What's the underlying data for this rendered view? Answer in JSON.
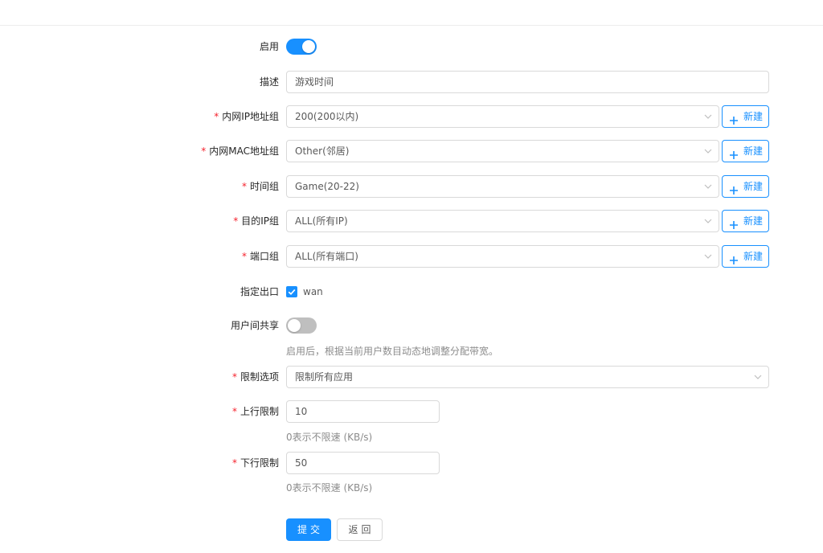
{
  "form": {
    "enable": {
      "label": "启用",
      "on": true
    },
    "description": {
      "label": "描述",
      "value": "游戏时间"
    },
    "lan_ip_group": {
      "required": "*",
      "label": "内网IP地址组",
      "value": "200(200以内)",
      "new_label": "新建"
    },
    "lan_mac_group": {
      "required": "*",
      "label": "内网MAC地址组",
      "value": "Other(邻居)",
      "new_label": "新建"
    },
    "time_group": {
      "required": "*",
      "label": "时间组",
      "value": "Game(20-22)",
      "new_label": "新建"
    },
    "dest_ip_group": {
      "required": "*",
      "label": "目的IP组",
      "value": "ALL(所有IP)",
      "new_label": "新建"
    },
    "port_group": {
      "required": "*",
      "label": "端口组",
      "value": "ALL(所有端口)",
      "new_label": "新建"
    },
    "egress": {
      "label": "指定出口",
      "option_label": "wan",
      "checked": true
    },
    "user_share": {
      "label": "用户间共享",
      "on": false,
      "hint": "启用后，根据当前用户数目动态地调整分配带宽。"
    },
    "limit_option": {
      "required": "*",
      "label": "限制选项",
      "value": "限制所有应用"
    },
    "upload_limit": {
      "required": "*",
      "label": "上行限制",
      "value": "10",
      "hint": "0表示不限速 (KB/s)"
    },
    "download_limit": {
      "required": "*",
      "label": "下行限制",
      "value": "50",
      "hint": "0表示不限速 (KB/s)"
    }
  },
  "actions": {
    "submit_label": "提交",
    "back_label": "返回"
  },
  "icons": {
    "select_arrow": "chevron-down-icon",
    "new_button": "plus-icon",
    "checkbox": "check-icon"
  },
  "colors": {
    "primary": "#1890ff",
    "required": "#f5222d",
    "switch_off": "#bfbfbf",
    "border": "#d9d9d9"
  }
}
